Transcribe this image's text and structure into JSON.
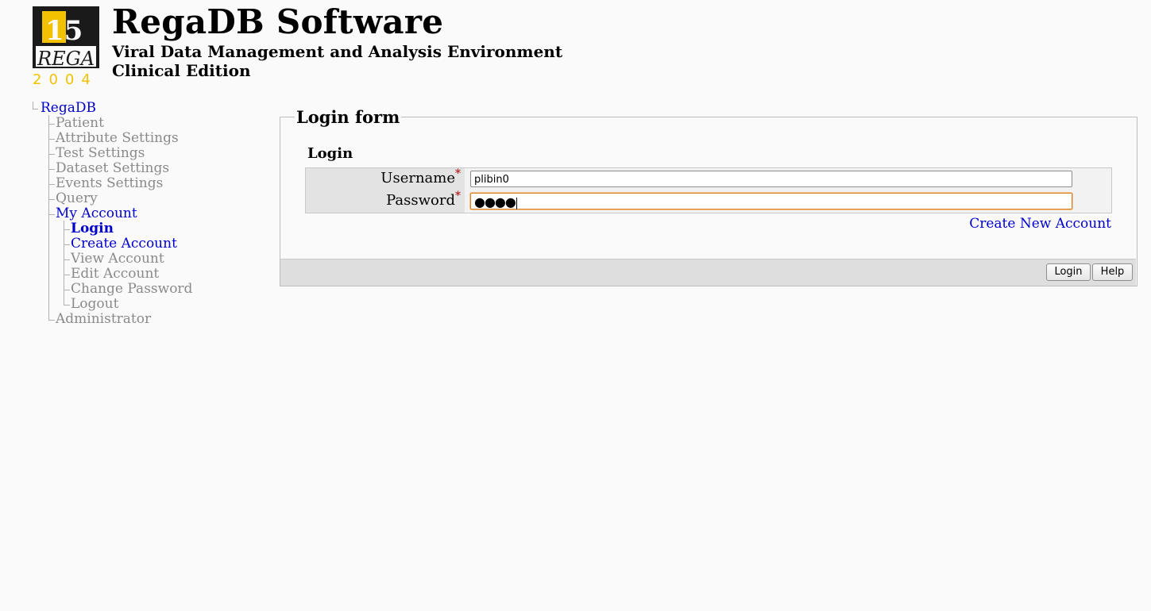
{
  "header": {
    "logo_text": "REGA",
    "logo_number": "15",
    "logo_year": "2004",
    "title": "RegaDB Software",
    "subtitle": "Viral Data Management and Analysis Environment",
    "edition": "Clinical Edition"
  },
  "nav": {
    "root": "RegaDB",
    "items": [
      {
        "label": "Patient",
        "enabled": false
      },
      {
        "label": "Attribute Settings",
        "enabled": false
      },
      {
        "label": "Test Settings",
        "enabled": false
      },
      {
        "label": "Dataset Settings",
        "enabled": false
      },
      {
        "label": "Events Settings",
        "enabled": false
      },
      {
        "label": "Query",
        "enabled": false
      },
      {
        "label": "My Account",
        "enabled": true
      },
      {
        "label": "Administrator",
        "enabled": false
      }
    ],
    "my_account_children": [
      {
        "label": "Login",
        "enabled": true,
        "current": true
      },
      {
        "label": "Create Account",
        "enabled": true
      },
      {
        "label": "View Account",
        "enabled": false
      },
      {
        "label": "Edit Account",
        "enabled": false
      },
      {
        "label": "Change Password",
        "enabled": false
      },
      {
        "label": "Logout",
        "enabled": false
      }
    ]
  },
  "form": {
    "legend": "Login form",
    "section_title": "Login",
    "username_label": "Username",
    "password_label": "Password",
    "required_marker": "*",
    "username_value": "plibin0",
    "password_masked": "●●●●",
    "create_link": "Create New Account",
    "login_button": "Login",
    "help_button": "Help"
  },
  "colors": {
    "link": "#0000cc",
    "disabled": "#8a8a8a",
    "focus_border": "#d9822b",
    "logo_yellow": "#f2c200"
  }
}
